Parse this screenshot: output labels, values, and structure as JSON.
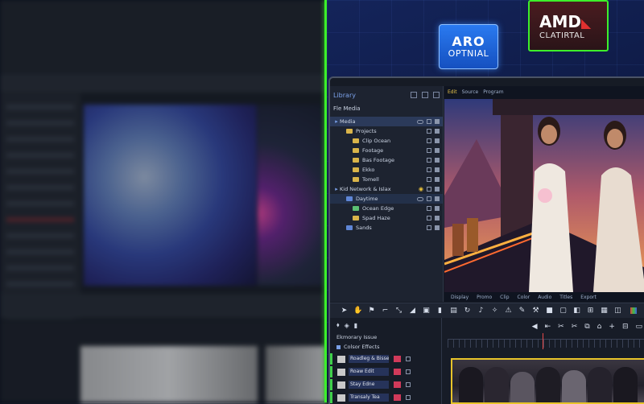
{
  "badges": {
    "left_line1": "ARO",
    "left_line2": "OPTNIAL",
    "right_line1": "AMD",
    "right_line2": "CLATIRTAL"
  },
  "app": {
    "panel_title": "Library",
    "panel_sub": "Fle Media",
    "tree": [
      {
        "label": "Media",
        "indent": 0,
        "kind": "root"
      },
      {
        "label": "Projects",
        "indent": 1,
        "kind": "folder"
      },
      {
        "label": "Clip Ocean",
        "indent": 2,
        "kind": "folder"
      },
      {
        "label": "Footage",
        "indent": 2,
        "kind": "folder"
      },
      {
        "label": "Bas Footage",
        "indent": 2,
        "kind": "folder"
      },
      {
        "label": "Ekko",
        "indent": 2,
        "kind": "folder"
      },
      {
        "label": "Tomell",
        "indent": 2,
        "kind": "folder"
      },
      {
        "label": "Kid Network & Islax",
        "indent": 0,
        "kind": "group"
      },
      {
        "label": "Daytime",
        "indent": 1,
        "kind": "folder-blue"
      },
      {
        "label": "Ocean Edge",
        "indent": 2,
        "kind": "folder-green"
      },
      {
        "label": "Spad Haze",
        "indent": 2,
        "kind": "folder"
      },
      {
        "label": "Sands",
        "indent": 1,
        "kind": "folder-blue"
      }
    ],
    "viewer_tabs": [
      "Edit",
      "Source",
      "Program"
    ],
    "viewer_caption": [
      "Display",
      "Promo",
      "Clip",
      "Color",
      "Audio",
      "Titles",
      "Export"
    ],
    "timeline": {
      "section_label": "Ekmorary Issue",
      "group_label": "Colsor Effects",
      "rows": [
        "Roadleg & Bisse",
        "Roaw Edit",
        "Stay Edne",
        "Transaly Tea"
      ]
    }
  }
}
